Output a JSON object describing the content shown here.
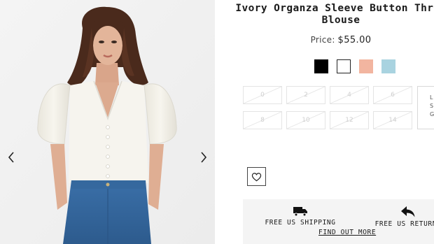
{
  "product": {
    "title_line1": "Ivory Organza Sleeve Button Throu",
    "title_line2": "Blouse",
    "price_label": "Price:",
    "price_value": "$55.00",
    "image_alt_icon": "product-photo"
  },
  "gallery": {
    "prev_icon": "chevron-left-icon",
    "next_icon": "chevron-right-icon"
  },
  "swatches": [
    {
      "color": "#000000",
      "selected": false
    },
    {
      "color": "#ffffff",
      "selected": true
    },
    {
      "color": "#f2b5a0",
      "selected": false
    },
    {
      "color": "#a9d3e0",
      "selected": false
    }
  ],
  "sizes": [
    "0",
    "2",
    "4",
    "6",
    "8",
    "10",
    "12",
    "14"
  ],
  "sizes_available": false,
  "size_guide": {
    "line1": "L",
    "line2": "S",
    "line3": "GU"
  },
  "wishlist_icon": "heart-icon",
  "delivery": {
    "shipping_label": "FREE US SHIPPING",
    "shipping_icon": "truck-icon",
    "returns_label": "FREE US RETURNS",
    "returns_icon": "return-arrow-icon",
    "find_out_more": "FIND OUT MORE"
  },
  "colors": {
    "text": "#1a1a1a",
    "size_disabled": "#cfcfcf",
    "delivery_bg": "#f4f4f4"
  }
}
